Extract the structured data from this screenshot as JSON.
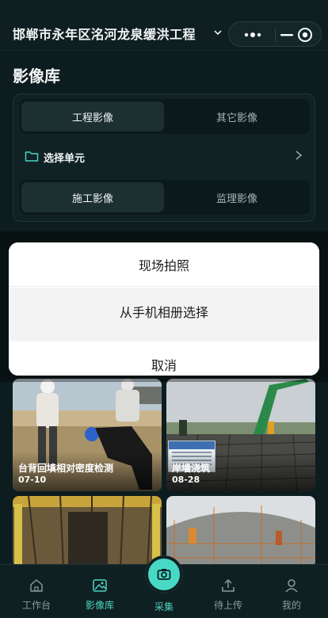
{
  "header": {
    "title": "邯郸市永年区洺河龙泉缓洪工程",
    "icons": [
      "chevron-down-icon",
      "more-dots-icon",
      "minimize-icon",
      "target-icon"
    ]
  },
  "page": {
    "title": "影像库"
  },
  "filters": {
    "category_tabs": [
      {
        "label": "工程影像",
        "active": true
      },
      {
        "label": "其它影像",
        "active": false
      }
    ],
    "unit_selector": {
      "label": "选择单元"
    },
    "type_tabs": [
      {
        "label": "施工影像",
        "active": true
      },
      {
        "label": "监理影像",
        "active": false
      }
    ]
  },
  "action_sheet": {
    "items": [
      "现场拍照",
      "从手机相册选择"
    ],
    "cancel": "取消"
  },
  "photos": [
    {
      "caption": "台背回填相对密度检测",
      "date": "07-10"
    },
    {
      "caption": "岸墙浇筑",
      "date": "08-28"
    },
    {
      "caption": "",
      "date": ""
    },
    {
      "caption": "",
      "date": ""
    }
  ],
  "tabbar": {
    "items": [
      {
        "label": "工作台",
        "icon": "home-icon",
        "active": false
      },
      {
        "label": "影像库",
        "icon": "image-icon",
        "active": true
      },
      {
        "label": "采集",
        "icon": "camera-icon",
        "active": false
      },
      {
        "label": "待上传",
        "icon": "upload-icon",
        "active": false
      },
      {
        "label": "我的",
        "icon": "user-icon",
        "active": false
      }
    ]
  },
  "colors": {
    "background": "#0d1c1e",
    "accent": "#48d8c6",
    "panel": "#112224",
    "sheet": "#ffffff"
  }
}
